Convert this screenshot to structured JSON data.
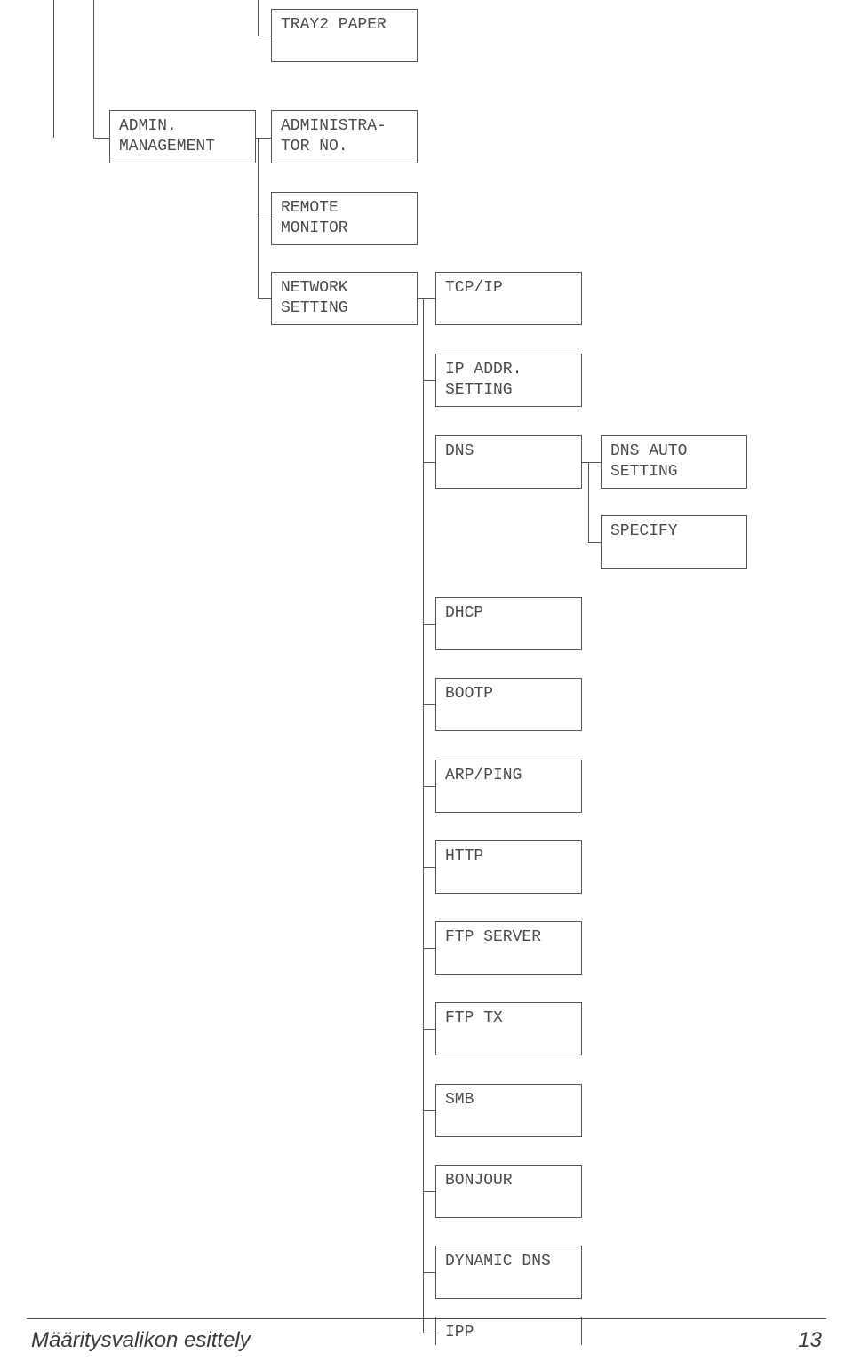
{
  "nodes": {
    "tray2": "TRAY2 PAPER",
    "admin_mgmt": "ADMIN.\nMANAGEMENT",
    "admin_no": "ADMINISTRA-\nTOR NO.",
    "remote": "REMOTE\nMONITOR",
    "network": "NETWORK\nSETTING",
    "tcpip": "TCP/IP",
    "ipaddr": "IP ADDR.\nSETTING",
    "dns": "DNS",
    "dns_auto": "DNS AUTO\nSETTING",
    "specify": "SPECIFY",
    "dhcp": "DHCP",
    "bootp": "BOOTP",
    "arpping": "ARP/PING",
    "http": "HTTP",
    "ftpserver": "FTP SERVER",
    "ftptx": "FTP TX",
    "smb": "SMB",
    "bonjour": "BONJOUR",
    "dyndns": "DYNAMIC DNS",
    "ipp": "IPP"
  },
  "footer": "Määritysvalikon esittely",
  "page": "13"
}
